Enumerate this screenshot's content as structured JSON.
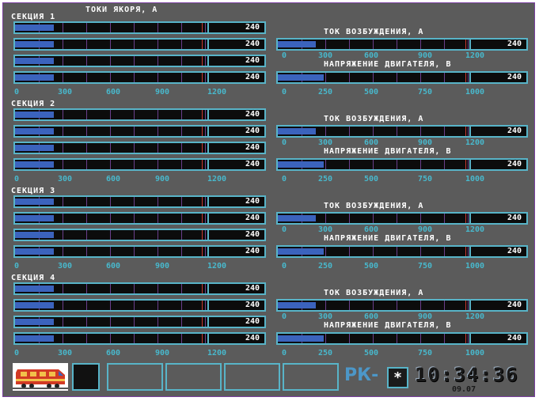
{
  "header": {
    "title": "ТОКИ ЯКОРЯ, А"
  },
  "sections": [
    {
      "label": "СЕКЦИЯ 1",
      "armature": [
        {
          "value": "240",
          "fraction": 0.2
        },
        {
          "value": "240",
          "fraction": 0.2
        },
        {
          "value": "240",
          "fraction": 0.2
        },
        {
          "value": "240",
          "fraction": 0.2
        }
      ],
      "excitation": {
        "label": "ТОК ВОЗБУЖДЕНИЯ, А",
        "value": "240",
        "fraction": 0.2
      },
      "voltage": {
        "label": "НАПРЯЖЕНИЕ ДВИГАТЕЛЯ, В",
        "value": "240",
        "fraction": 0.24
      }
    },
    {
      "label": "СЕКЦИЯ 2",
      "armature": [
        {
          "value": "240",
          "fraction": 0.2
        },
        {
          "value": "240",
          "fraction": 0.2
        },
        {
          "value": "240",
          "fraction": 0.2
        },
        {
          "value": "240",
          "fraction": 0.2
        }
      ],
      "excitation": {
        "label": "ТОК ВОЗБУЖДЕНИЯ, А",
        "value": "240",
        "fraction": 0.2
      },
      "voltage": {
        "label": "НАПРЯЖЕНИЕ ДВИГАТЕЛЯ, В",
        "value": "240",
        "fraction": 0.24
      }
    },
    {
      "label": "СЕКЦИЯ 3",
      "armature": [
        {
          "value": "240",
          "fraction": 0.2
        },
        {
          "value": "240",
          "fraction": 0.2
        },
        {
          "value": "240",
          "fraction": 0.2
        },
        {
          "value": "240",
          "fraction": 0.2
        }
      ],
      "excitation": {
        "label": "ТОК ВОЗБУЖДЕНИЯ, А",
        "value": "240",
        "fraction": 0.2
      },
      "voltage": {
        "label": "НАПРЯЖЕНИЕ ДВИГАТЕЛЯ, В",
        "value": "240",
        "fraction": 0.24
      }
    },
    {
      "label": "СЕКЦИЯ 4",
      "armature": [
        {
          "value": "240",
          "fraction": 0.2
        },
        {
          "value": "240",
          "fraction": 0.2
        },
        {
          "value": "240",
          "fraction": 0.2
        },
        {
          "value": "240",
          "fraction": 0.2
        }
      ],
      "excitation": {
        "label": "ТОК ВОЗБУЖДЕНИЯ, А",
        "value": "240",
        "fraction": 0.2
      },
      "voltage": {
        "label": "НАПРЯЖЕНИЕ ДВИГАТЕЛЯ, В",
        "value": "240",
        "fraction": 0.24
      }
    }
  ],
  "scales": {
    "armature": [
      "0",
      "300",
      "600",
      "900",
      "1200"
    ],
    "excitation": [
      "0",
      "300",
      "600",
      "900",
      "1200"
    ],
    "voltage": [
      "0",
      "250",
      "500",
      "750",
      "1000"
    ]
  },
  "footer": {
    "mode_label": "РК-",
    "mode_value": "*",
    "time": "10:34:36",
    "date": "09.07"
  },
  "colors": {
    "fill": "#3b63bd",
    "frame": "#58b4c8",
    "tick": "#48b8cc",
    "background": "#5b5b5b",
    "grid": "#6a3f8c",
    "limit": "#c8392e"
  }
}
